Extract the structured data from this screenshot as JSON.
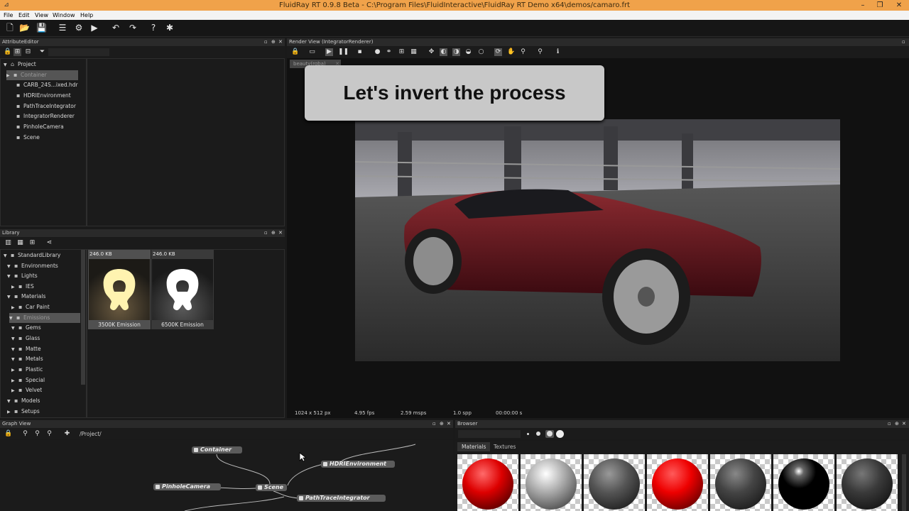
{
  "window": {
    "title": "FluidRay RT 0.9.8 Beta - C:\\Program Files\\FluidInteractive\\FluidRay RT Demo x64\\demos/camaro.frt"
  },
  "menu": [
    "File",
    "Edit",
    "View",
    "Window",
    "Help"
  ],
  "panels": {
    "attribute_editor": "AttributeEditor",
    "library": "Library",
    "render_view": "Render View (IntegratorRenderer)",
    "graph_view": "Graph View",
    "browser": "Browser"
  },
  "attribute_tree": {
    "root": "Project",
    "items": [
      "Container",
      "CARB_24S...ixed.hdr",
      "HDRIEnvironment",
      "PathTraceIntegrator",
      "IntegratorRenderer",
      "PinholeCamera",
      "Scene"
    ]
  },
  "library_tree": [
    "StandardLibrary",
    "Environments",
    "Lights",
    "IES",
    "Materials",
    "Car Paint",
    "Emissions",
    "Gems",
    "Glass",
    "Matte",
    "Metals",
    "Plastic",
    "Special",
    "Velvet",
    "Models",
    "Setups"
  ],
  "library_thumbs": [
    {
      "size": "246.0 KB",
      "label": "3500K Emission"
    },
    {
      "size": "246.0 KB",
      "label": "6500K Emission"
    }
  ],
  "render": {
    "tab": "beauty(rgba)",
    "caption": "Let's invert the process",
    "status": {
      "resolution": "1024 x 512 px",
      "fps": "4.95 fps",
      "msps": "2.59 msps",
      "spp": "1.0 spp",
      "time": "00:00:00 s"
    }
  },
  "graph": {
    "path": "/Project/",
    "nodes": [
      "Container",
      "HDRIEnvironment",
      "PinholeCamera",
      "Scene",
      "PathTraceIntegrator"
    ]
  },
  "browser": {
    "tabs": [
      "Materials",
      "Textures"
    ]
  },
  "colors": {
    "accent_titlebar": "#f0a24a",
    "selection": "#555555"
  }
}
